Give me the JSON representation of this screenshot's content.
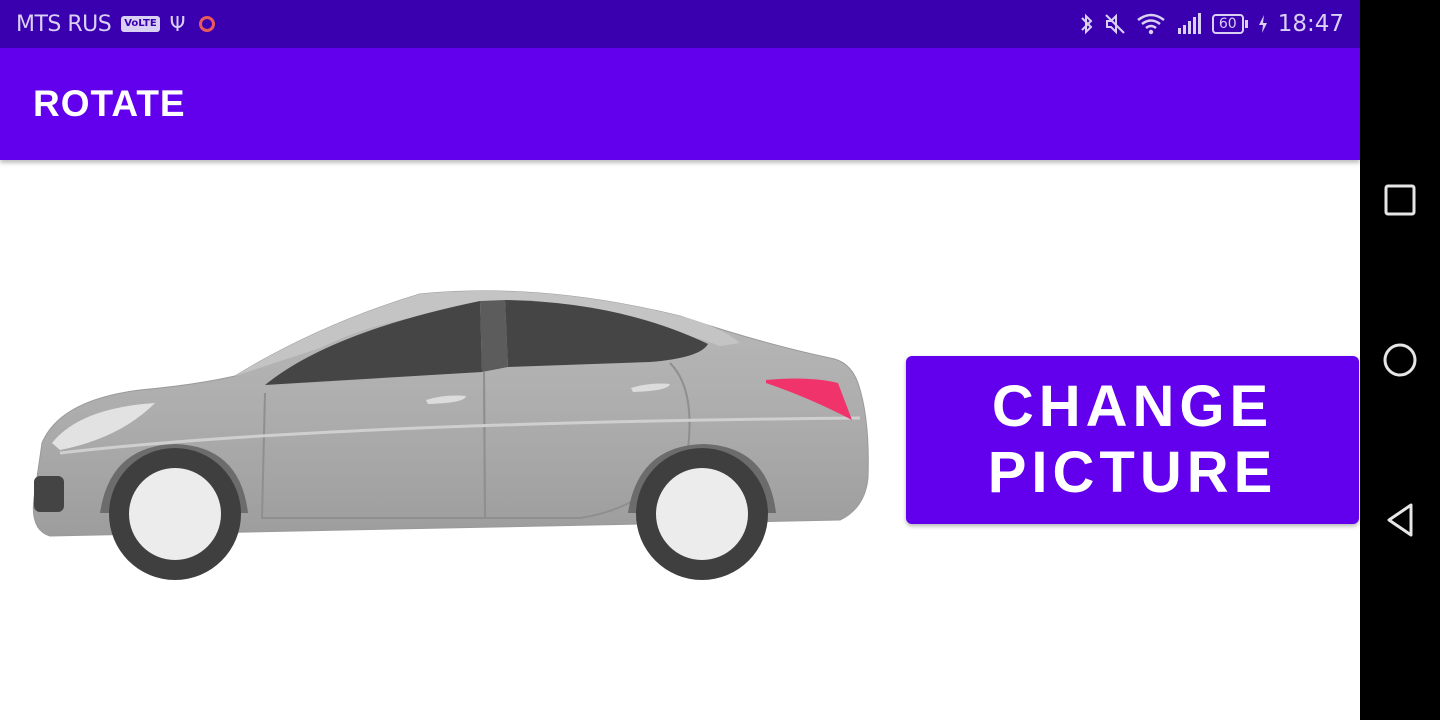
{
  "status_bar": {
    "carrier": "MTS RUS",
    "volte": "VoLTE",
    "usb_glyph": "Ψ",
    "battery_level": "60",
    "time": "18:47",
    "icons": [
      "bluetooth-icon",
      "mute-icon",
      "wifi-icon",
      "signal-icon",
      "battery-icon",
      "charging-icon"
    ]
  },
  "app_bar": {
    "title": "ROTATE"
  },
  "main": {
    "image_subject": "silver sedan car, side view",
    "button": {
      "line1": "CHANGE",
      "line2": "PICTURE"
    }
  },
  "nav_bar": {
    "icons": [
      "recents-square-icon",
      "home-circle-icon",
      "back-triangle-icon"
    ]
  },
  "colors": {
    "status_bar": "#3a00b0",
    "app_bar": "#6200ee",
    "button": "#6200ee",
    "background": "#ffffff",
    "nav_bar": "#000000"
  }
}
